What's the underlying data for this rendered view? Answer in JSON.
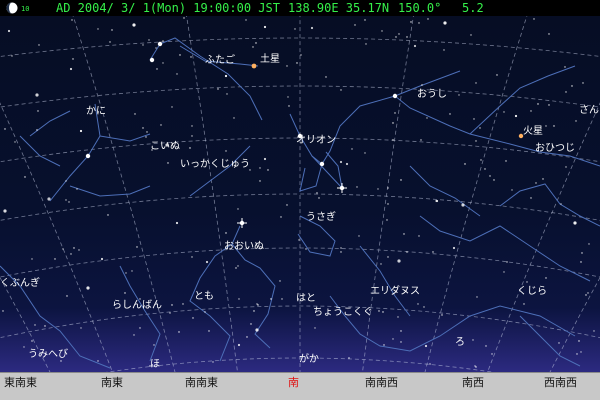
{
  "status": {
    "moon_age": "10",
    "datetime": "AD 2004/ 3/ 1(Mon) 19:00:00 JST",
    "longitude_latitude": "138.90E 35.17N",
    "azimuth": "150.0°",
    "magnitude": "5.2"
  },
  "constellations": [
    {
      "id": "futago",
      "label": "ふたご"
    },
    {
      "id": "kani",
      "label": "かに"
    },
    {
      "id": "koinu",
      "label": "こいぬ"
    },
    {
      "id": "ikkakujuu",
      "label": "いっかくじゅう"
    },
    {
      "id": "orion",
      "label": "オリオン"
    },
    {
      "id": "oushi",
      "label": "おうし"
    },
    {
      "id": "ohitsuji",
      "label": "おひつじ"
    },
    {
      "id": "san",
      "label": "さん"
    },
    {
      "id": "usagi",
      "label": "うさぎ"
    },
    {
      "id": "ooinu",
      "label": "おおいぬ"
    },
    {
      "id": "kubunki",
      "label": "くぶんぎ"
    },
    {
      "id": "rashinban",
      "label": "らしんばん"
    },
    {
      "id": "tomo",
      "label": "とも"
    },
    {
      "id": "hato",
      "label": "はと"
    },
    {
      "id": "eridanus",
      "label": "エリダヌス"
    },
    {
      "id": "kujira",
      "label": "くじら"
    },
    {
      "id": "choukokugu",
      "label": "ちょうこくぐ"
    },
    {
      "id": "ro",
      "label": "ろ"
    },
    {
      "id": "umihebi",
      "label": "うみへび"
    },
    {
      "id": "ho",
      "label": "ほ"
    },
    {
      "id": "gaga",
      "label": "がか"
    }
  ],
  "planets": [
    {
      "id": "saturn",
      "label": "土星"
    },
    {
      "id": "mars",
      "label": "火星"
    }
  ],
  "directions": [
    {
      "id": "ese",
      "label": "東南東",
      "active": false
    },
    {
      "id": "se",
      "label": "南東",
      "active": false
    },
    {
      "id": "sse",
      "label": "南南東",
      "active": false
    },
    {
      "id": "s",
      "label": "南",
      "active": true
    },
    {
      "id": "ssw",
      "label": "南南西",
      "active": false
    },
    {
      "id": "sw",
      "label": "南西",
      "active": false
    },
    {
      "id": "wsw",
      "label": "西南西",
      "active": false
    }
  ],
  "colors": {
    "status_text": "#35f04a",
    "line": "#4d6fb8",
    "grid": "#c8d0e8",
    "direction_active": "#e01010",
    "direction_bar": "#c8c8c8",
    "planet": "#ffb060"
  }
}
